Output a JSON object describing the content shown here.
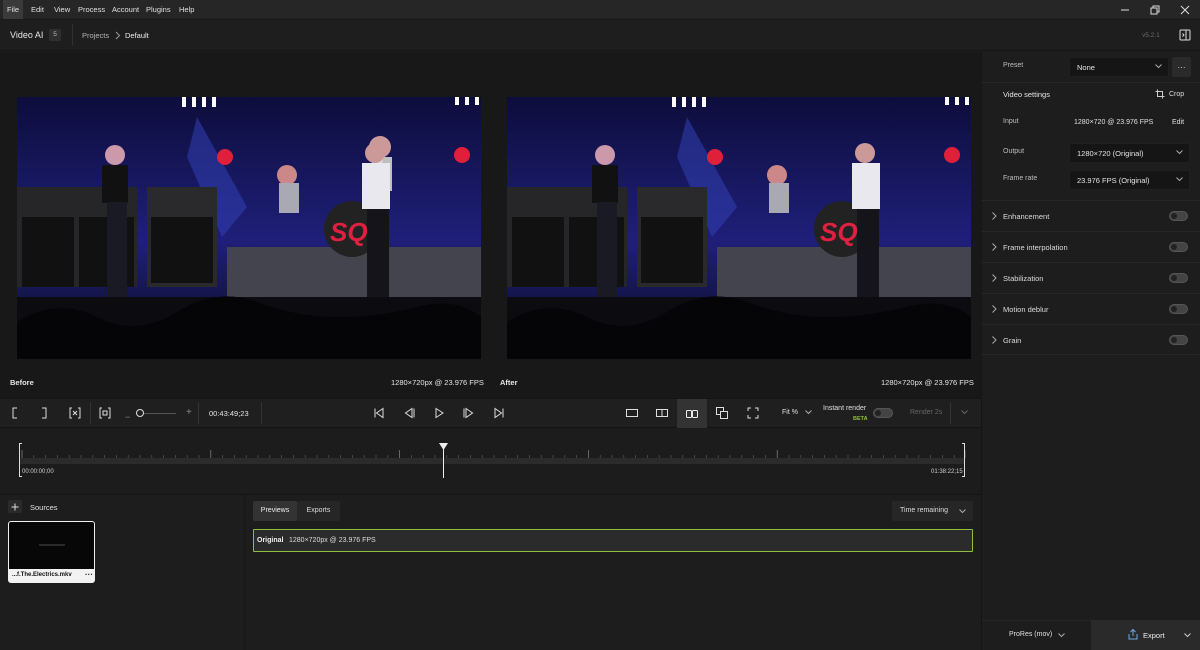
{
  "menubar": {
    "items": [
      "File",
      "Edit",
      "View",
      "Process",
      "Account",
      "Plugins",
      "Help"
    ]
  },
  "header": {
    "app_name": "Video AI",
    "app_badge": "5",
    "breadcrumb_root": "Projects",
    "breadcrumb_current": "Default",
    "version": "v5.2.1"
  },
  "preview": {
    "before_label": "Before",
    "before_info": "1280×720px @ 23.976 FPS",
    "after_label": "After",
    "after_info": "1280×720px @ 23.976 FPS"
  },
  "controls": {
    "timecode": "00:43:49;23",
    "fit_label": "Fit %",
    "instant_render_label": "Instant render",
    "beta_label": "BETA",
    "render_label": "Render 2s"
  },
  "timeline": {
    "start_time": "00:00:00;00",
    "end_time": "01:38:22;15",
    "playhead_fraction": 0.4475
  },
  "sources": {
    "title": "Sources",
    "file_name": "...f.The.Electrics.mkv"
  },
  "queue": {
    "tabs": [
      "Previews",
      "Exports"
    ],
    "sort_label": "Time remaining",
    "row_label": "Original",
    "row_info": "1280×720px @ 23.976 FPS"
  },
  "panel": {
    "preset_label": "Preset",
    "preset_value": "None",
    "video_settings_label": "Video settings",
    "crop_label": "Crop",
    "input_label": "Input",
    "input_value": "1280×720 @ 23.976 FPS",
    "edit_label": "Edit",
    "output_label": "Output",
    "output_value": "1280×720 (Original)",
    "frame_rate_label": "Frame rate",
    "frame_rate_value": "23.976 FPS (Original)",
    "sections": [
      "Enhancement",
      "Frame interpolation",
      "Stabilization",
      "Motion deblur",
      "Grain"
    ],
    "format_label": "ProRes (mov)",
    "export_label": "Export"
  },
  "colors": {
    "accent_green": "#8fbf3a",
    "export_bg": "#2a2a2a",
    "stage_blue": "#1a1b6e"
  }
}
